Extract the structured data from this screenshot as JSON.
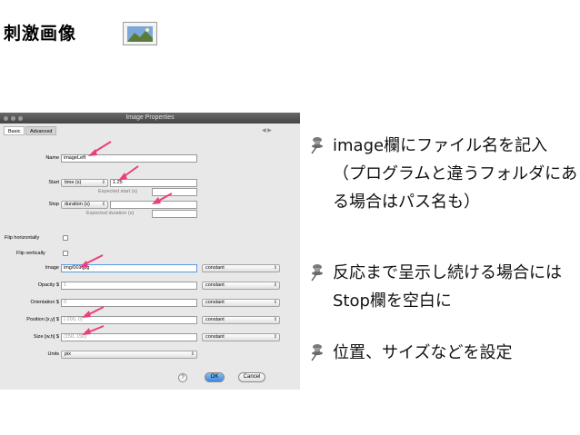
{
  "slide": {
    "title": "刺激画像",
    "icon": "image-picture-icon"
  },
  "dialog": {
    "window_title": "Image Properties",
    "tabs": [
      {
        "label": "Basic",
        "active": true
      },
      {
        "label": "Advanced",
        "active": false
      }
    ],
    "tab_arrows": "◀ ▶",
    "fields": {
      "name": {
        "label": "Name",
        "value": "imageLeft"
      },
      "start": {
        "label": "Start",
        "type": "time (s)",
        "value": "1.25",
        "hint": "Expected start (s)"
      },
      "stop": {
        "label": "Stop",
        "type": "duration (s)",
        "value": "",
        "hint": "Expected duration (s)"
      },
      "flip_h": {
        "label": "Flip horizontally",
        "checked": false
      },
      "flip_v": {
        "label": "Flip vertically",
        "checked": false
      },
      "image": {
        "label": "Image",
        "value": "img/001.jpg",
        "mode": "constant"
      },
      "opacity": {
        "label": "Opacity $",
        "value": "1",
        "mode": "constant"
      },
      "orientation": {
        "label": "Orientation $",
        "value": "0",
        "mode": "constant"
      },
      "position": {
        "label": "Position [x,y] $",
        "value": "(-200, 0)",
        "mode": "constant"
      },
      "size": {
        "label": "Size [w,h] $",
        "value": "(150, 150)",
        "mode": "constant"
      },
      "units": {
        "label": "Units",
        "value": "pix"
      }
    },
    "buttons": {
      "help": "?",
      "ok": "OK",
      "cancel": "Cancel"
    },
    "colors": {
      "arrow": "#e8407a",
      "ok_button": "#3b88e0"
    }
  },
  "bullets": [
    {
      "text": "image欄にファイル名を記入（プログラムと違うフォルダにある場合はパス名も）"
    },
    {
      "text": "反応まで呈示し続ける場合にはStop欄を空白に"
    },
    {
      "text": "位置、サイズなどを設定"
    }
  ],
  "icons": {
    "bullet": "pushpin-icon"
  }
}
